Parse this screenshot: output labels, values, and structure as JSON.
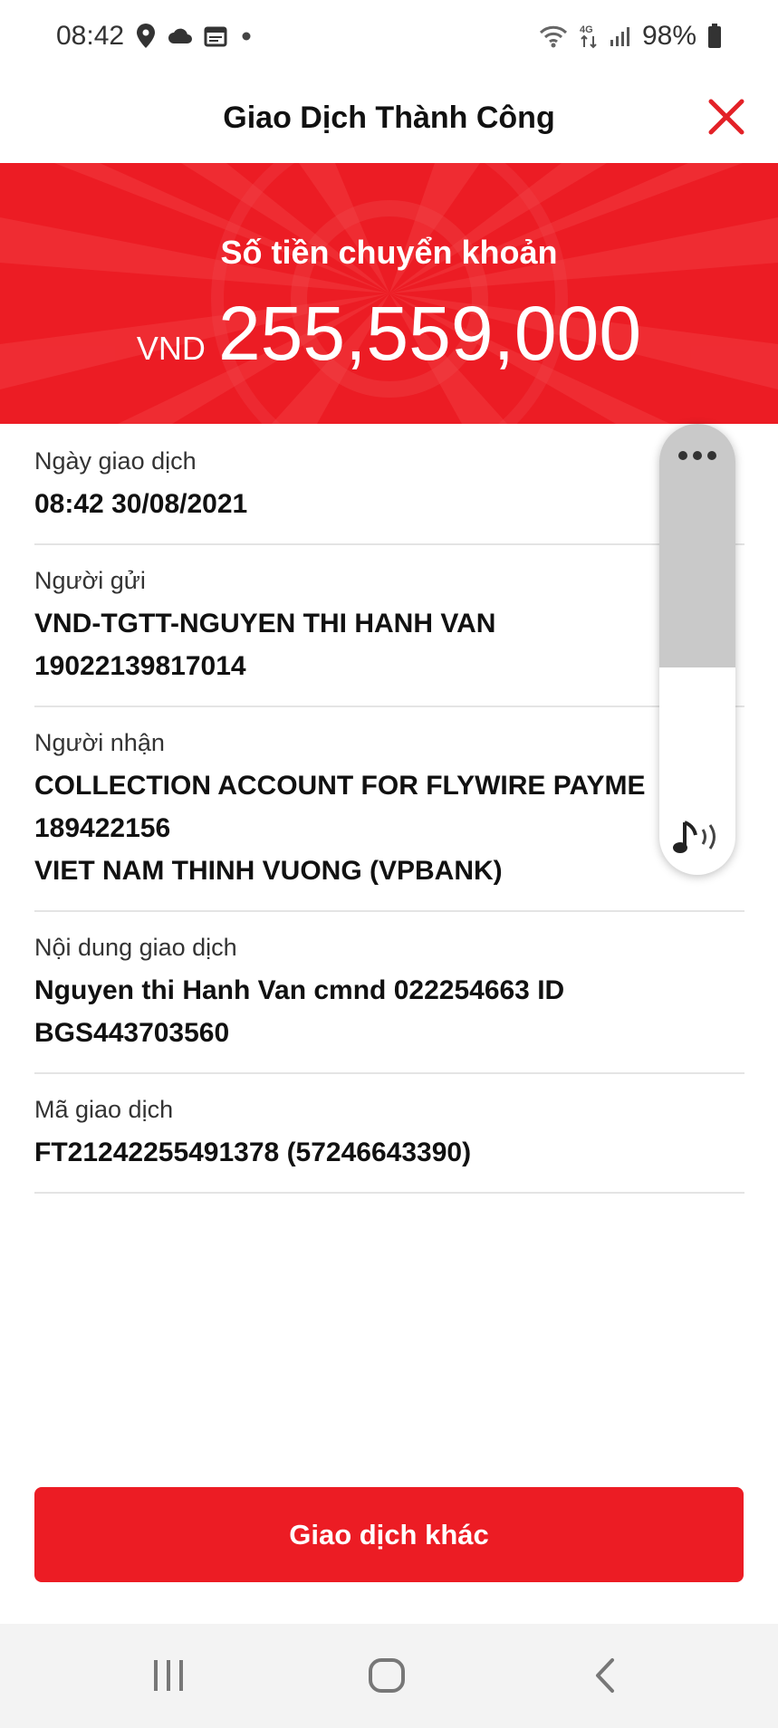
{
  "status_bar": {
    "time": "08:42",
    "icons_left": [
      "location-icon",
      "cloud-icon",
      "calendar-icon",
      "dot-icon"
    ],
    "network_label": "4G",
    "battery": "98%"
  },
  "header": {
    "title": "Giao Dịch Thành Công",
    "close_icon": "close-icon"
  },
  "hero": {
    "label": "Số tiền chuyển khoản",
    "currency": "VND",
    "amount": "255,559,000",
    "background_color": "#ec1c24"
  },
  "details": [
    {
      "label": "Ngày giao dịch",
      "lines": [
        "08:42 30/08/2021"
      ]
    },
    {
      "label": "Người gửi",
      "lines": [
        "VND-TGTT-NGUYEN THI HANH VAN",
        "19022139817014"
      ]
    },
    {
      "label": "Người nhận",
      "lines": [
        "COLLECTION ACCOUNT FOR FLYWIRE PAYME",
        "189422156",
        "VIET NAM THINH VUONG (VPBANK)"
      ]
    },
    {
      "label": "Nội dung giao dịch",
      "lines": [
        "Nguyen thi Hanh Van cmnd 022254663 ID",
        "BGS443703560"
      ]
    },
    {
      "label": "Mã giao dịch",
      "lines": [
        "FT21242255491378 (57246643390)"
      ]
    }
  ],
  "volume_widget": {
    "menu_icon": "more-dots-icon",
    "sound_icon": "music-note-icon",
    "level": 0.56
  },
  "action_button": {
    "label": "Giao dịch khác"
  },
  "nav_bar": {
    "recent_icon": "recent-apps-icon",
    "home_icon": "home-icon",
    "back_icon": "back-icon"
  }
}
